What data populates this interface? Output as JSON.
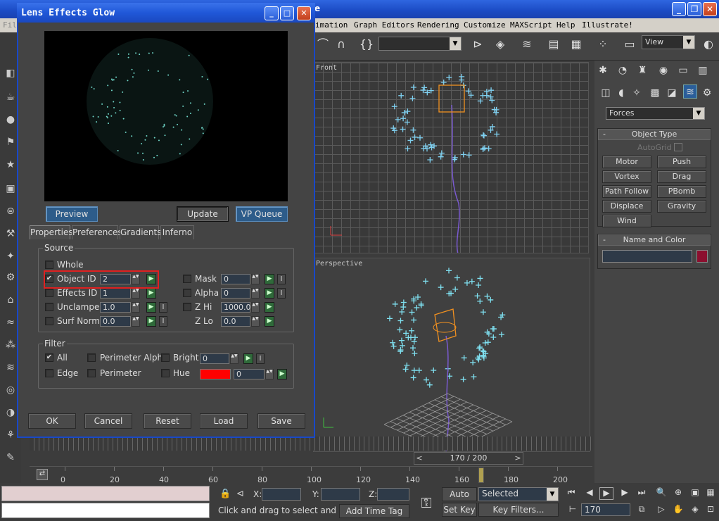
{
  "app": {
    "title_tail": "e",
    "menu": [
      "imation",
      "Graph Editors",
      "Rendering",
      "Customize",
      "MAXScript",
      "Help",
      "Illustrate!"
    ],
    "menu_left_fragment": "Fil",
    "view_select": "View",
    "viewports": {
      "front": "Front",
      "perspective": "Perspective"
    }
  },
  "command_panel": {
    "category": "Forces",
    "object_type": {
      "header": "Object Type",
      "autogrid": "AutoGrid",
      "buttons": [
        "Motor",
        "Push",
        "Vortex",
        "Drag",
        "Path Follow",
        "PBomb",
        "Displace",
        "Gravity",
        "Wind"
      ]
    },
    "name_color": {
      "header": "Name and Color",
      "minus": "-"
    },
    "minus": "-",
    "swatch_color": "#8c0f2f"
  },
  "timeline": {
    "frame_display": "170 / 200",
    "ticks": [
      "0",
      "20",
      "40",
      "60",
      "80",
      "100",
      "120",
      "140",
      "160",
      "180",
      "200"
    ]
  },
  "status": {
    "x_label": "X:",
    "y_label": "Y:",
    "z_label": "Z:",
    "auto_key": "Auto Key",
    "set_key": "Set Key",
    "selected": "Selected",
    "key_filters": "Key Filters...",
    "frame": "170",
    "prompt": "Click and drag to select and move",
    "add_time_tag": "Add Time Tag"
  },
  "dialog": {
    "title": "Lens Effects Glow",
    "buttons": {
      "preview": "Preview",
      "update": "Update",
      "vp_queue": "VP Queue"
    },
    "tabs": [
      "Properties",
      "Preferences",
      "Gradients",
      "Inferno"
    ],
    "source": {
      "label": "Source",
      "whole": "Whole",
      "object_id": {
        "label": "Object ID",
        "value": "2",
        "checked": true
      },
      "effects_id": {
        "label": "Effects ID",
        "value": "1"
      },
      "unclamped": {
        "label": "Unclamped",
        "value": "1.0"
      },
      "surf_norm": {
        "label": "Surf Norm",
        "value": "0.0"
      },
      "mask": {
        "label": "Mask",
        "value": "0"
      },
      "alpha": {
        "label": "Alpha",
        "value": "0"
      },
      "z_hi": {
        "label": "Z Hi",
        "value": "1000.0"
      },
      "z_lo": {
        "label": "Z Lo",
        "value": "0.0"
      },
      "i_label": "I"
    },
    "filter": {
      "label": "Filter",
      "all": "All",
      "edge": "Edge",
      "perimeter_alpha": "Perimeter Alpha",
      "perimeter": "Perimeter",
      "bright": {
        "label": "Bright",
        "value": "0"
      },
      "hue": {
        "label": "Hue",
        "value": "0",
        "color": "#ff0000"
      }
    },
    "footer": {
      "ok": "OK",
      "cancel": "Cancel",
      "reset": "Reset",
      "load": "Load",
      "save": "Save"
    },
    "check_mark": "✔",
    "map_glyph": "▶",
    "spin_glyph": "▲▼"
  }
}
